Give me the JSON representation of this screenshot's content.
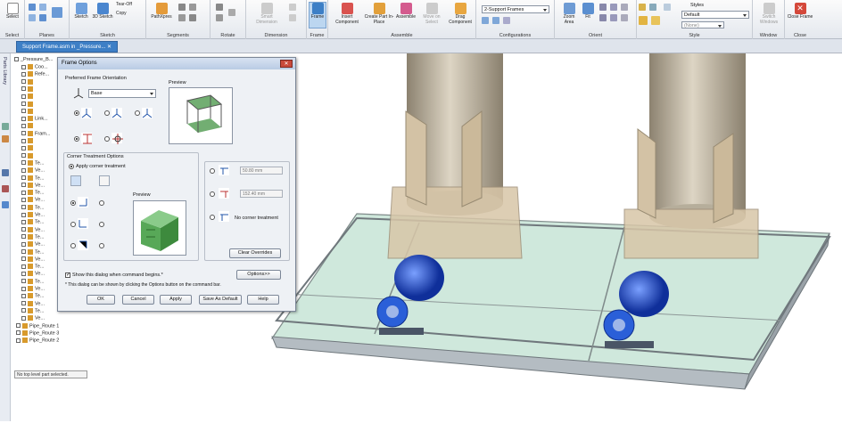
{
  "ribbon": {
    "groups": [
      {
        "label": "Select"
      },
      {
        "label": "Planes"
      },
      {
        "label": "Sketch"
      },
      {
        "label": "Segments"
      },
      {
        "label": "Rotate"
      },
      {
        "label": "Dimension"
      },
      {
        "label": "Frame"
      },
      {
        "label": "Assemble"
      },
      {
        "label": "Configurations"
      },
      {
        "label": "Orient"
      },
      {
        "label": "Style"
      },
      {
        "label": "Window"
      },
      {
        "label": "Close"
      }
    ],
    "buttons": {
      "select": "Select",
      "sketch": "Sketch",
      "sketch3d": "3D Sketch",
      "tear_off": "Tear-Off",
      "copy": "Copy",
      "pathxpres": "PathXpres",
      "smart_dimension": "Smart Dimension",
      "frame": "Frame",
      "insert_component": "Insert Component",
      "create_part_inplace": "Create Part In-Place",
      "assemble": "Assemble",
      "move_on_select": "Move on Select",
      "drag_component": "Drag Component",
      "zoom_area": "Zoom Area",
      "fit": "Fit",
      "switch_windows": "Switch Windows",
      "close_frame": "Close Frame"
    },
    "config_value": "2-Support Frames",
    "styles_label": "Styles",
    "style_value": "Default",
    "style_none": "(None)"
  },
  "document_tab": "Support Frame.asm in _Pressure...",
  "tree": {
    "root": "_Pressure_B...",
    "items": [
      "Coo...",
      "Refe...",
      "",
      "",
      "",
      "",
      "",
      "Link...",
      "",
      "Fram...",
      "",
      "",
      "",
      "Te...",
      "Ve...",
      "Te...",
      "Ve...",
      "Te...",
      "Ve...",
      "Te...",
      "Ve...",
      "Te...",
      "Ve...",
      "Te...",
      "Ve...",
      "Te...",
      "Ve...",
      "Te...",
      "Ve...",
      "Te...",
      "Ve...",
      "Te...",
      "Ve...",
      "Te...",
      "Ve...",
      "Pipe_Route 1",
      "Pipe_Route 3",
      "Pipe_Route 2"
    ],
    "left_tab": "Parts Library"
  },
  "status_text": "No top level part selected.",
  "dialog": {
    "title": "Frame Options",
    "orientation_label": "Preferred Frame Orientation",
    "orientation_value": "Base",
    "preview_label": "Preview",
    "corner_label": "Corner Treatment Options",
    "apply_corner": "Apply corner treatment",
    "preview2_label": "Preview",
    "gap1": "50.80 mm",
    "gap2": "152.40 mm",
    "no_corner": "No corner treatment",
    "clear_overrides": "Clear Overrides",
    "show_dialog": "Show this dialog when command begins.*",
    "options_btn": "Options>>",
    "note": "* This dialog can be shown by clicking the Options button on the command bar.",
    "ok": "OK",
    "cancel": "Cancel",
    "apply": "Apply",
    "save_default": "Save As Default",
    "help": "Help"
  },
  "colors": {
    "frame_blue": "#3d7fc6",
    "glass": "#cfe8dc",
    "tank": "#c8bfae",
    "pump": "#1f56c8"
  }
}
